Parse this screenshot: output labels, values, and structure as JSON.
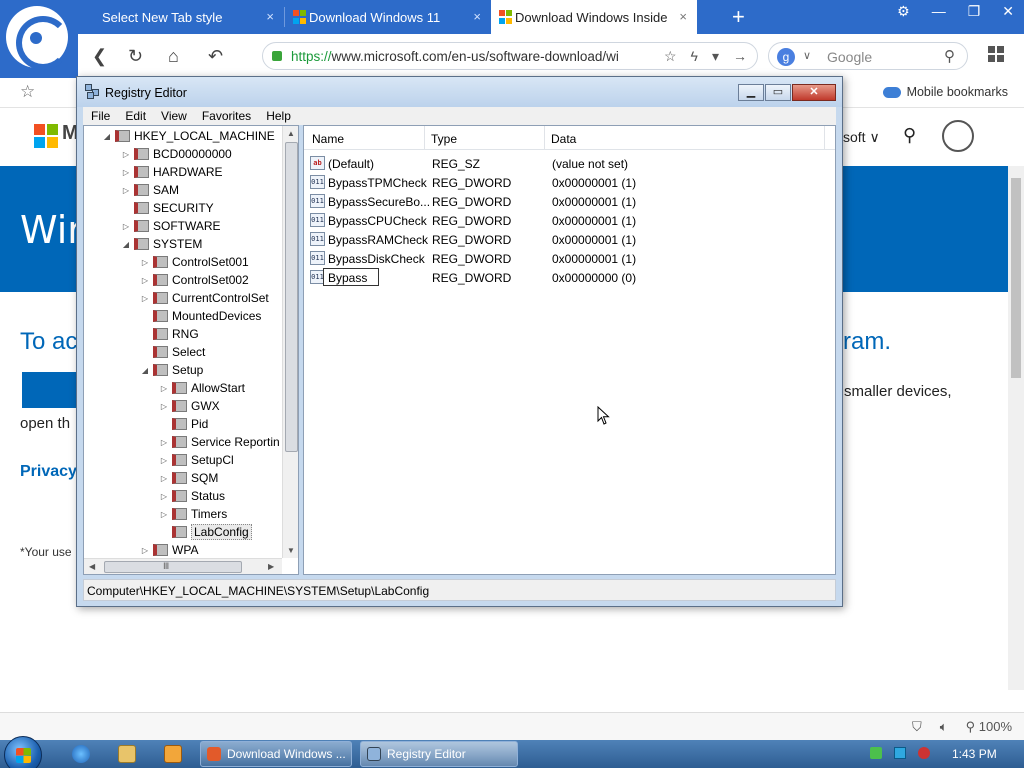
{
  "browser": {
    "tabs": [
      {
        "label": "Select New Tab style",
        "active": false
      },
      {
        "label": "Download Windows 11",
        "active": false
      },
      {
        "label": "Download Windows Inside",
        "active": true
      }
    ],
    "tab_close": "×",
    "new_tab": "+",
    "window_controls": [
      "⚙",
      "—",
      "❐",
      "✕"
    ],
    "url_scheme": "https://",
    "url_rest": "www.microsoft.com/en-us/software-download/wi",
    "search_placeholder": "Google",
    "search_badge": "g",
    "mobile_bookmarks": "Mobile bookmarks",
    "zoom": "100%"
  },
  "webpage": {
    "brand_partial": "M",
    "nav_right": "soft ∨",
    "banner_title": "Wir",
    "heading_left": "To ac",
    "heading_right": "ram.",
    "text_right": "smaller devices,",
    "text_left": "open th",
    "privacy": "Privacy",
    "footnote": "*Your use"
  },
  "regedit": {
    "title": "Registry Editor",
    "menu": [
      "File",
      "Edit",
      "View",
      "Favorites",
      "Help"
    ],
    "tree": [
      {
        "label": "HKEY_LOCAL_MACHINE",
        "depth": 0,
        "expander": "◢"
      },
      {
        "label": "BCD00000000",
        "depth": 1,
        "expander": "▷"
      },
      {
        "label": "HARDWARE",
        "depth": 1,
        "expander": "▷"
      },
      {
        "label": "SAM",
        "depth": 1,
        "expander": "▷"
      },
      {
        "label": "SECURITY",
        "depth": 1,
        "expander": ""
      },
      {
        "label": "SOFTWARE",
        "depth": 1,
        "expander": "▷"
      },
      {
        "label": "SYSTEM",
        "depth": 1,
        "expander": "◢"
      },
      {
        "label": "ControlSet001",
        "depth": 2,
        "expander": "▷"
      },
      {
        "label": "ControlSet002",
        "depth": 2,
        "expander": "▷"
      },
      {
        "label": "CurrentControlSet",
        "depth": 2,
        "expander": "▷"
      },
      {
        "label": "MountedDevices",
        "depth": 2,
        "expander": ""
      },
      {
        "label": "RNG",
        "depth": 2,
        "expander": ""
      },
      {
        "label": "Select",
        "depth": 2,
        "expander": ""
      },
      {
        "label": "Setup",
        "depth": 2,
        "expander": "◢"
      },
      {
        "label": "AllowStart",
        "depth": 3,
        "expander": "▷"
      },
      {
        "label": "GWX",
        "depth": 3,
        "expander": "▷"
      },
      {
        "label": "Pid",
        "depth": 3,
        "expander": ""
      },
      {
        "label": "Service Reportin",
        "depth": 3,
        "expander": "▷"
      },
      {
        "label": "SetupCl",
        "depth": 3,
        "expander": "▷"
      },
      {
        "label": "SQM",
        "depth": 3,
        "expander": "▷"
      },
      {
        "label": "Status",
        "depth": 3,
        "expander": "▷"
      },
      {
        "label": "Timers",
        "depth": 3,
        "expander": "▷"
      },
      {
        "label": "LabConfig",
        "depth": 3,
        "expander": "",
        "selected": true
      },
      {
        "label": "WPA",
        "depth": 2,
        "expander": "▷"
      }
    ],
    "columns": [
      "Name",
      "Type",
      "Data"
    ],
    "values": [
      {
        "name": "(Default)",
        "type": "REG_SZ",
        "data": "(value not set)",
        "icon": "ab"
      },
      {
        "name": "BypassTPMCheck",
        "type": "REG_DWORD",
        "data": "0x00000001 (1)",
        "icon": "011"
      },
      {
        "name": "BypassSecureBo...",
        "type": "REG_DWORD",
        "data": "0x00000001 (1)",
        "icon": "011"
      },
      {
        "name": "BypassCPUCheck",
        "type": "REG_DWORD",
        "data": "0x00000001 (1)",
        "icon": "011"
      },
      {
        "name": "BypassRAMCheck",
        "type": "REG_DWORD",
        "data": "0x00000001 (1)",
        "icon": "011"
      },
      {
        "name": "BypassDiskCheck",
        "type": "REG_DWORD",
        "data": "0x00000001 (1)",
        "icon": "011"
      },
      {
        "name": "Bypass",
        "type": "REG_DWORD",
        "data": "0x00000000 (0)",
        "icon": "011",
        "editing": true
      }
    ],
    "status_path": "Computer\\HKEY_LOCAL_MACHINE\\SYSTEM\\Setup\\LabConfig",
    "scroll_glyph": "Ⅲ"
  },
  "taskbar": {
    "tasks": [
      {
        "label": "Download Windows ...",
        "active": false
      },
      {
        "label": "Registry Editor",
        "active": true
      }
    ],
    "clock": "1:43 PM"
  }
}
